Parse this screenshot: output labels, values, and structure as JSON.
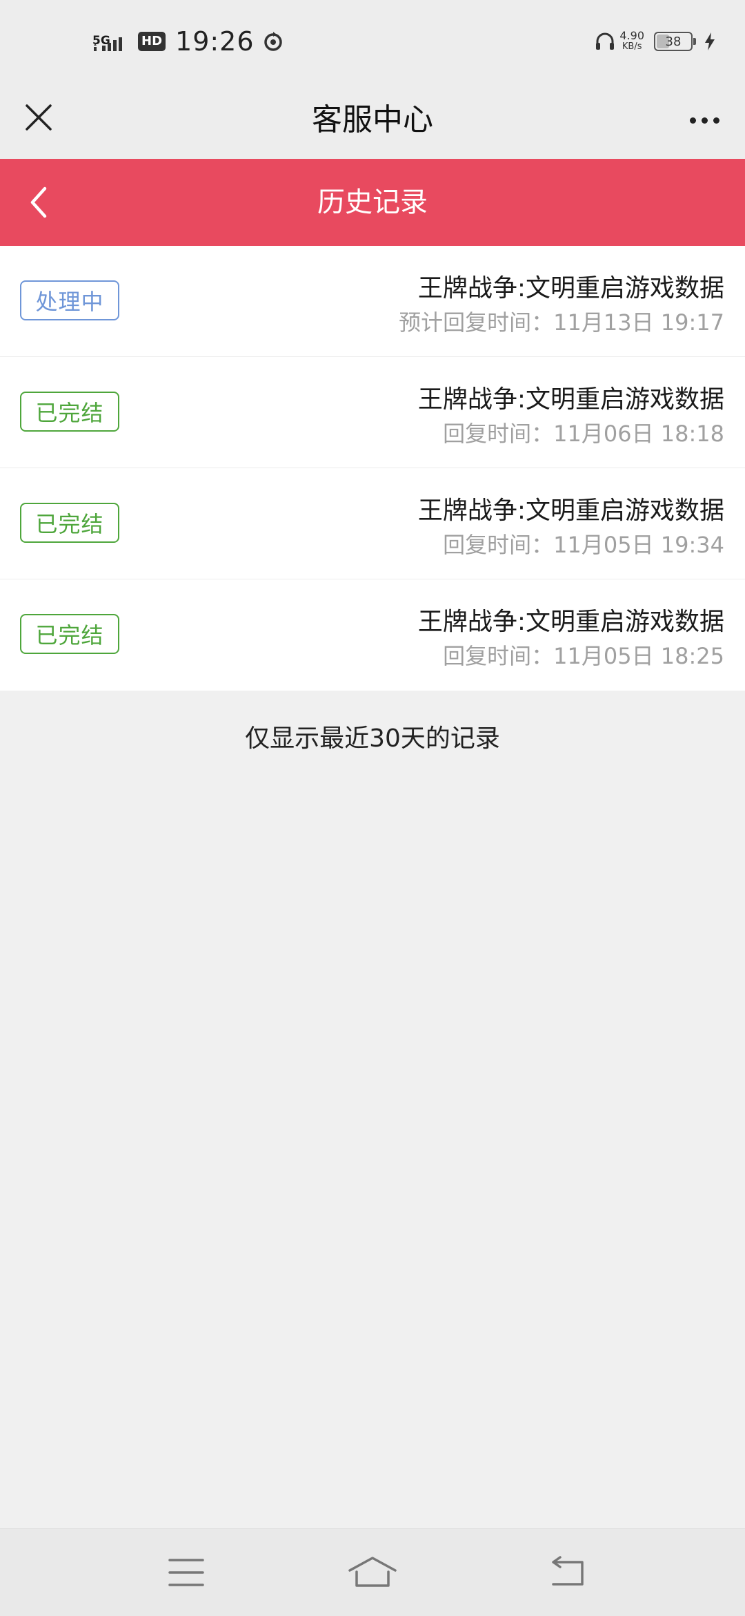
{
  "status_bar": {
    "network": "5G",
    "hd": "HD",
    "time": "19:26",
    "speed_value": "4.90",
    "speed_unit": "KB/s",
    "battery": "38",
    "battery_level": 0.38
  },
  "header": {
    "title": "客服中心"
  },
  "section": {
    "title": "历史记录"
  },
  "records": [
    {
      "status": "处理中",
      "title": "王牌战争:文明重启游戏数据",
      "sub": "预计回复时间：11月13日 19:17"
    },
    {
      "status": "已完结",
      "title": "王牌战争:文明重启游戏数据",
      "sub": "回复时间：11月06日 18:18"
    },
    {
      "status": "已完结",
      "title": "王牌战争:文明重启游戏数据",
      "sub": "回复时间：11月05日 19:34"
    },
    {
      "status": "已完结",
      "title": "王牌战争:文明重启游戏数据",
      "sub": "回复时间：11月05日 18:25"
    }
  ],
  "note": "仅显示最近30天的记录",
  "colors": {
    "accent": "#e84a5f",
    "processing": "#6f96d8",
    "done": "#4ea63b"
  }
}
